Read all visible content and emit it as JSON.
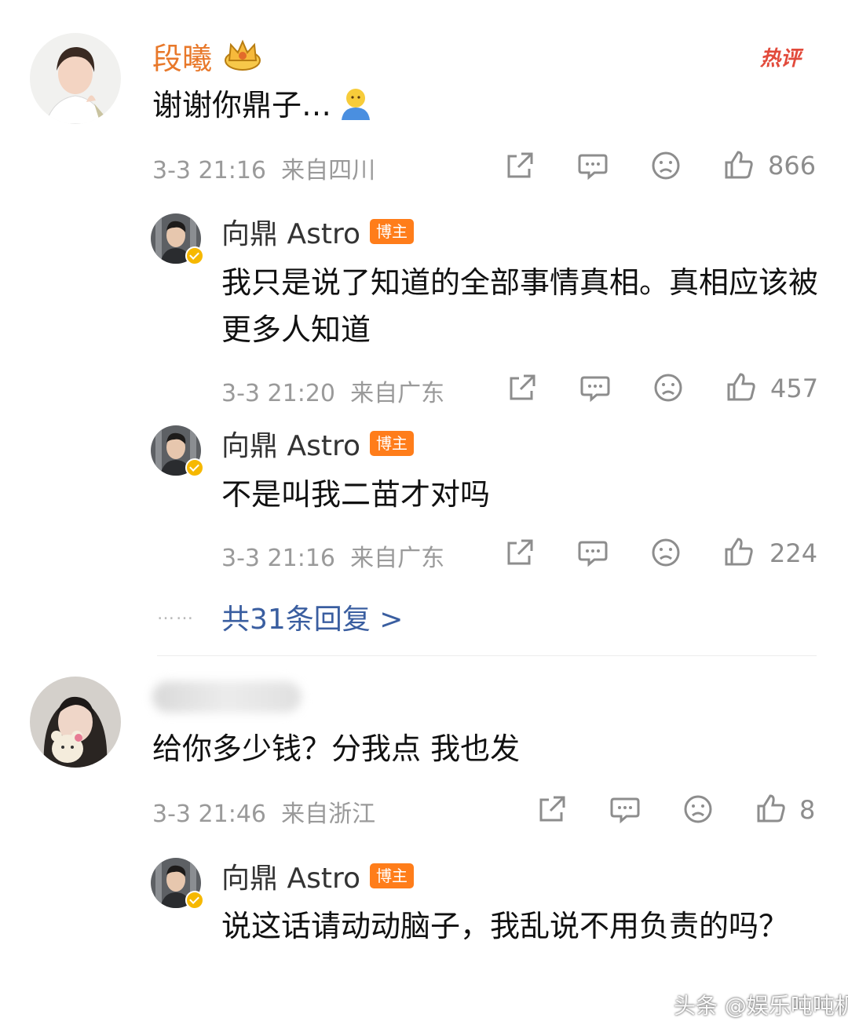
{
  "comments": [
    {
      "user": "段曦",
      "tag": "热评",
      "text": "谢谢你鼎子…",
      "time": "3-3 21:16",
      "location": "来自四川",
      "likes": "866"
    },
    {
      "user": "",
      "text": "给你多少钱？分我点 我也发",
      "time": "3-3 21:46",
      "location": "来自浙江",
      "likes": "8"
    }
  ],
  "replies": [
    {
      "user": "向鼎 Astro",
      "badge": "博主",
      "text": "我只是说了知道的全部事情真相。真相应该被更多人知道",
      "time": "3-3 21:20",
      "location": "来自广东",
      "likes": "457"
    },
    {
      "user": "向鼎 Astro",
      "badge": "博主",
      "text": "不是叫我二苗才对吗",
      "time": "3-3 21:16",
      "location": "来自广东",
      "likes": "224"
    },
    {
      "user": "向鼎 Astro",
      "badge": "博主",
      "text": "说这话请动动脑子，我乱说不用负责的吗？"
    }
  ],
  "more_replies": "共31条回复 >",
  "more_dots": "……",
  "watermark": "头条 @娱乐吨吨机",
  "icons": {
    "share": "share-icon",
    "comment": "comment-icon",
    "dislike": "sad-face-icon",
    "like": "thumbs-up-icon",
    "crown": "crown-icon",
    "emoji": "person-emoji-icon"
  },
  "colors": {
    "top_name": "#e8782a",
    "badge": "#ff7d1a",
    "link": "#3a5ea0",
    "hot": "#e24a3b"
  }
}
